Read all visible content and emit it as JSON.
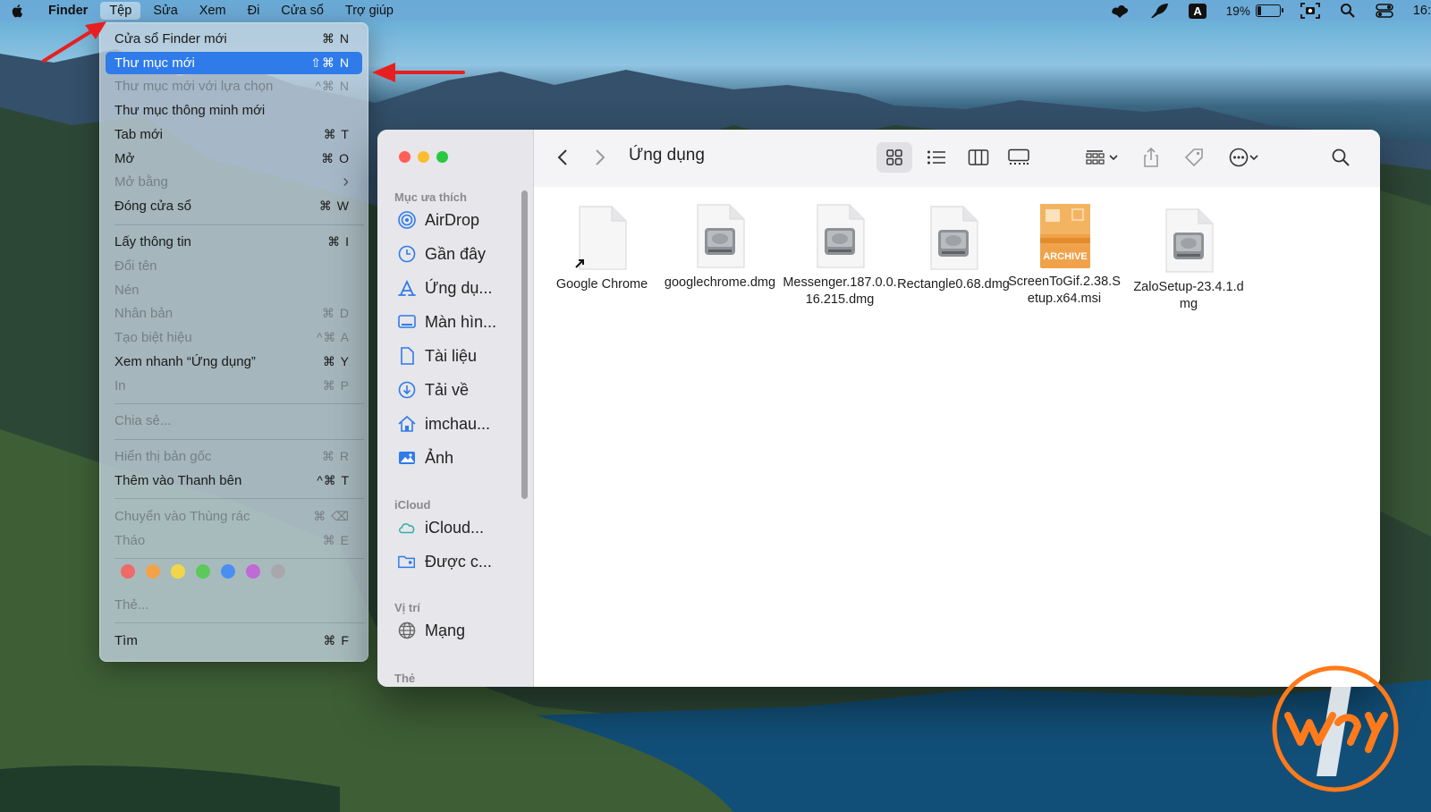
{
  "menubar": {
    "items": [
      "Finder",
      "Tệp",
      "Sửa",
      "Xem",
      "Đi",
      "Cửa sổ",
      "Trợ giúp"
    ],
    "battery_percent": "19%",
    "battery_level": 0.19,
    "keyboard_input": "A",
    "clock": "16:"
  },
  "menu": {
    "items": [
      {
        "label": "Cửa sổ Finder mới",
        "shortcut": "⌘ N"
      },
      {
        "label": "Thư mục mới",
        "shortcut": "⇧⌘ N"
      },
      {
        "label": "Thư mục mới với lựa chọn",
        "shortcut": "^⌘ N"
      },
      {
        "label": "Thư mục thông minh mới",
        "shortcut": ""
      },
      {
        "label": "Tab mới",
        "shortcut": "⌘ T"
      },
      {
        "label": "Mở",
        "shortcut": "⌘ O"
      },
      {
        "label": "Mở bằng",
        "shortcut": "›"
      },
      {
        "label": "Đóng cửa sổ",
        "shortcut": "⌘ W"
      },
      {
        "label": "Lấy thông tin",
        "shortcut": "⌘ I"
      },
      {
        "label": "Đổi tên",
        "shortcut": ""
      },
      {
        "label": "Nén",
        "shortcut": ""
      },
      {
        "label": "Nhân bản",
        "shortcut": "⌘ D"
      },
      {
        "label": "Tạo biệt hiệu",
        "shortcut": "^⌘ A"
      },
      {
        "label": "Xem nhanh “Ứng dụng”",
        "shortcut": "⌘ Y"
      },
      {
        "label": "In",
        "shortcut": "⌘ P"
      },
      {
        "label": "Chia sẻ...",
        "shortcut": ""
      },
      {
        "label": "Hiển thị bản gốc",
        "shortcut": "⌘ R"
      },
      {
        "label": "Thêm vào Thanh bên",
        "shortcut": "^⌘ T"
      },
      {
        "label": "Chuyển vào Thùng rác",
        "shortcut": "⌘ ⌫"
      },
      {
        "label": "Tháo",
        "shortcut": "⌘ E"
      },
      {
        "label": "Thẻ...",
        "shortcut": ""
      },
      {
        "label": "Tìm",
        "shortcut": "⌘ F"
      }
    ],
    "tag_colors": [
      "#f06a6a",
      "#f2a34a",
      "#f2d64a",
      "#5cc95c",
      "#4a8ef2",
      "#c06ad6",
      "#a8a8ac"
    ]
  },
  "finder": {
    "title": "Ứng dụng",
    "sidebar": {
      "favorites_header": "Mục ưa thích",
      "favorites": [
        "AirDrop",
        "Gần đây",
        "Ứng dụ...",
        "Màn hìn...",
        "Tài liệu",
        "Tải về",
        "imchau...",
        "Ảnh"
      ],
      "icloud_header": "iCloud",
      "icloud": [
        "iCloud...",
        "Được c..."
      ],
      "locations_header": "Vị trí",
      "locations": [
        "Mạng"
      ],
      "tags_header": "Thẻ"
    },
    "files": [
      {
        "name": "Google Chrome"
      },
      {
        "name": "googlechrome.dmg"
      },
      {
        "name": "Messenger.187.0.0.16.215.dmg"
      },
      {
        "name": "Rectangle0.68.dmg"
      },
      {
        "name": "ScreenToGif.2.38.Setup.x64.msi",
        "badge": "ARCHIVE"
      },
      {
        "name": "ZaloSetup-23.4.1.dmg"
      }
    ]
  }
}
